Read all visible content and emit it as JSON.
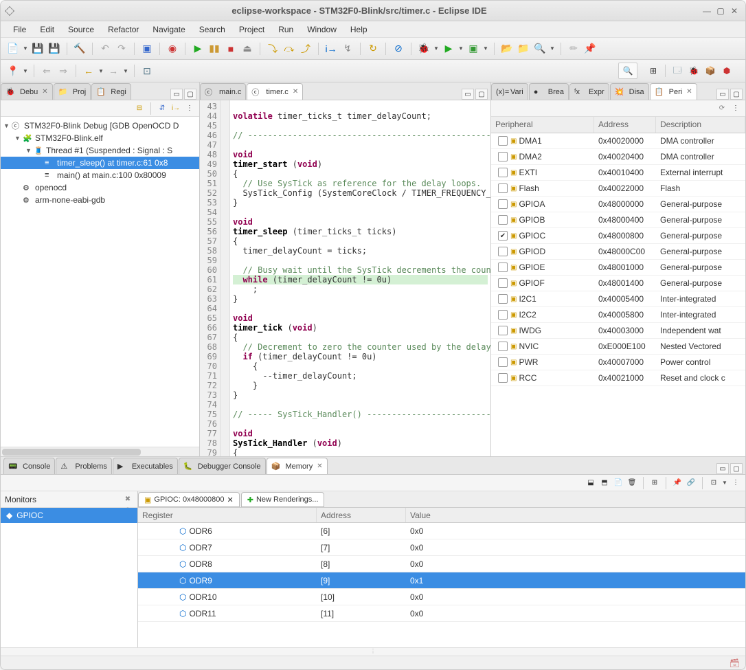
{
  "window": {
    "title": "eclipse-workspace - STM32F0-Blink/src/timer.c - Eclipse IDE"
  },
  "menu": [
    "File",
    "Edit",
    "Source",
    "Refactor",
    "Navigate",
    "Search",
    "Project",
    "Run",
    "Window",
    "Help"
  ],
  "left_tabs": [
    {
      "icon": "🐞",
      "label": "Debu",
      "close": true
    },
    {
      "icon": "📁",
      "label": "Proj"
    },
    {
      "icon": "📋",
      "label": "Regi"
    }
  ],
  "debug_tree": [
    {
      "indent": 0,
      "toggle": "▼",
      "icon": "ⓒ",
      "label": "STM32F0-Blink Debug [GDB OpenOCD D"
    },
    {
      "indent": 1,
      "toggle": "▼",
      "icon": "🧩",
      "label": "STM32F0-Blink.elf"
    },
    {
      "indent": 2,
      "toggle": "▼",
      "icon": "🧵",
      "label": "Thread #1 (Suspended : Signal : S"
    },
    {
      "indent": 3,
      "toggle": "",
      "icon": "≡",
      "label": "timer_sleep() at timer.c:61 0x8",
      "selected": true
    },
    {
      "indent": 3,
      "toggle": "",
      "icon": "≡",
      "label": "main() at main.c:100 0x80009"
    },
    {
      "indent": 1,
      "toggle": "",
      "icon": "⚙",
      "label": "openocd"
    },
    {
      "indent": 1,
      "toggle": "",
      "icon": "⚙",
      "label": "arm-none-eabi-gdb"
    }
  ],
  "editor_tabs": [
    {
      "icon": "ⓒ",
      "label": "main.c"
    },
    {
      "icon": "ⓒ",
      "label": "timer.c",
      "active": true,
      "close": true
    }
  ],
  "code_start_line": 43,
  "code_lines": [
    {
      "t": ""
    },
    {
      "t": "volatile timer_ticks_t timer_delayCount;",
      "kw": [
        "volatile"
      ]
    },
    {
      "t": ""
    },
    {
      "t": "// ----------------------------------------------------",
      "cm": true
    },
    {
      "t": ""
    },
    {
      "t": "void",
      "kw": [
        "void"
      ]
    },
    {
      "t": "timer_start (void)",
      "fn": "timer_start",
      "kw": [
        "void"
      ]
    },
    {
      "t": "{"
    },
    {
      "t": "  // Use SysTick as reference for the delay loops.",
      "cm": true
    },
    {
      "t": "  SysTick_Config (SystemCoreClock / TIMER_FREQUENCY_HZ"
    },
    {
      "t": "}"
    },
    {
      "t": ""
    },
    {
      "t": "void",
      "kw": [
        "void"
      ]
    },
    {
      "t": "timer_sleep (timer_ticks_t ticks)",
      "fn": "timer_sleep"
    },
    {
      "t": "{"
    },
    {
      "t": "  timer_delayCount = ticks;"
    },
    {
      "t": ""
    },
    {
      "t": "  // Busy wait until the SysTick decrements the counte",
      "cm": true
    },
    {
      "t": "  while (timer_delayCount != 0u)",
      "kw": [
        "while"
      ],
      "hl": true
    },
    {
      "t": "    ;"
    },
    {
      "t": "}"
    },
    {
      "t": ""
    },
    {
      "t": "void",
      "kw": [
        "void"
      ]
    },
    {
      "t": "timer_tick (void)",
      "fn": "timer_tick",
      "kw": [
        "void"
      ]
    },
    {
      "t": "{"
    },
    {
      "t": "  // Decrement to zero the counter used by the delay r",
      "cm": true
    },
    {
      "t": "  if (timer_delayCount != 0u)",
      "kw": [
        "if"
      ]
    },
    {
      "t": "    {"
    },
    {
      "t": "      --timer_delayCount;"
    },
    {
      "t": "    }"
    },
    {
      "t": "}"
    },
    {
      "t": ""
    },
    {
      "t": "// ----- SysTick_Handler() ---------------------------",
      "cm": true
    },
    {
      "t": ""
    },
    {
      "t": "void",
      "kw": [
        "void"
      ]
    },
    {
      "t": "SysTick_Handler (void)",
      "fn": "SysTick_Handler",
      "kw": [
        "void"
      ]
    },
    {
      "t": "{"
    }
  ],
  "right_tabs": [
    {
      "icon": "(x)=",
      "label": "Vari"
    },
    {
      "icon": "●",
      "label": "Brea"
    },
    {
      "icon": "ᶠx",
      "label": "Expr"
    },
    {
      "icon": "💥",
      "label": "Disa"
    },
    {
      "icon": "📋",
      "label": "Peri",
      "active": true,
      "close": true
    }
  ],
  "periph_cols": [
    "Peripheral",
    "Address",
    "Description"
  ],
  "periph": [
    {
      "name": "DMA1",
      "addr": "0x40020000",
      "desc": "DMA controller"
    },
    {
      "name": "DMA2",
      "addr": "0x40020400",
      "desc": "DMA controller"
    },
    {
      "name": "EXTI",
      "addr": "0x40010400",
      "desc": "External interrupt"
    },
    {
      "name": "Flash",
      "addr": "0x40022000",
      "desc": "Flash"
    },
    {
      "name": "GPIOA",
      "addr": "0x48000000",
      "desc": "General-purpose"
    },
    {
      "name": "GPIOB",
      "addr": "0x48000400",
      "desc": "General-purpose"
    },
    {
      "name": "GPIOC",
      "addr": "0x48000800",
      "desc": "General-purpose",
      "checked": true
    },
    {
      "name": "GPIOD",
      "addr": "0x48000C00",
      "desc": "General-purpose"
    },
    {
      "name": "GPIOE",
      "addr": "0x48001000",
      "desc": "General-purpose"
    },
    {
      "name": "GPIOF",
      "addr": "0x48001400",
      "desc": "General-purpose"
    },
    {
      "name": "I2C1",
      "addr": "0x40005400",
      "desc": "Inter-integrated"
    },
    {
      "name": "I2C2",
      "addr": "0x40005800",
      "desc": "Inter-integrated"
    },
    {
      "name": "IWDG",
      "addr": "0x40003000",
      "desc": "Independent wat"
    },
    {
      "name": "NVIC",
      "addr": "0xE000E100",
      "desc": "Nested Vectored"
    },
    {
      "name": "PWR",
      "addr": "0x40007000",
      "desc": "Power control"
    },
    {
      "name": "RCC",
      "addr": "0x40021000",
      "desc": "Reset and clock c"
    }
  ],
  "bottom_tabs": [
    {
      "icon": "📟",
      "label": "Console"
    },
    {
      "icon": "⚠",
      "label": "Problems"
    },
    {
      "icon": "▶",
      "label": "Executables"
    },
    {
      "icon": "🐛",
      "label": "Debugger Console"
    },
    {
      "icon": "📦",
      "label": "Memory",
      "active": true,
      "close": true
    }
  ],
  "monitors_title": "Monitors",
  "monitor_item": "GPIOC",
  "mem_tab_title": "GPIOC: 0x48000800",
  "mem_new_rendering": "New Renderings...",
  "mem_cols": [
    "Register",
    "Address",
    "Value"
  ],
  "mem_rows": [
    {
      "reg": "ODR6",
      "addr": "[6]",
      "val": "0x0"
    },
    {
      "reg": "ODR7",
      "addr": "[7]",
      "val": "0x0"
    },
    {
      "reg": "ODR8",
      "addr": "[8]",
      "val": "0x0"
    },
    {
      "reg": "ODR9",
      "addr": "[9]",
      "val": "0x1",
      "selected": true
    },
    {
      "reg": "ODR10",
      "addr": "[10]",
      "val": "0x0"
    },
    {
      "reg": "ODR11",
      "addr": "[11]",
      "val": "0x0"
    }
  ]
}
